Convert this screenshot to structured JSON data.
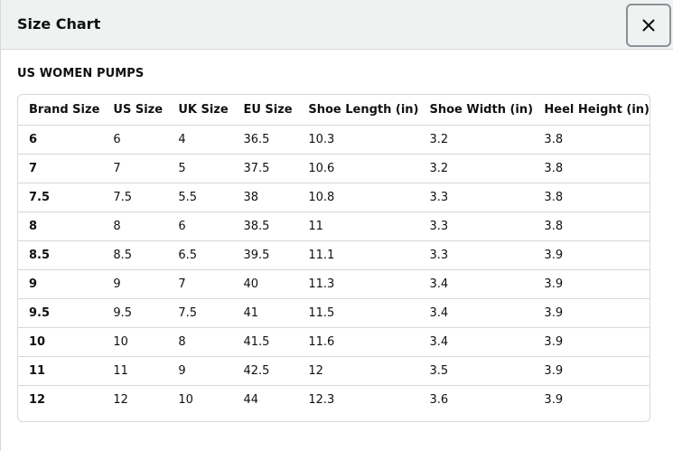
{
  "modal": {
    "title": "Size Chart",
    "close_icon": "close-icon"
  },
  "section_title": "US WOMEN PUMPS",
  "table": {
    "headers": [
      "Brand Size",
      "US Size",
      "UK Size",
      "EU Size",
      "Shoe Length (in)",
      "Shoe Width (in)",
      "Heel Height (in)"
    ],
    "rows": [
      [
        "6",
        "6",
        "4",
        "36.5",
        "10.3",
        "3.2",
        "3.8"
      ],
      [
        "7",
        "7",
        "5",
        "37.5",
        "10.6",
        "3.2",
        "3.8"
      ],
      [
        "7.5",
        "7.5",
        "5.5",
        "38",
        "10.8",
        "3.3",
        "3.8"
      ],
      [
        "8",
        "8",
        "6",
        "38.5",
        "11",
        "3.3",
        "3.8"
      ],
      [
        "8.5",
        "8.5",
        "6.5",
        "39.5",
        "11.1",
        "3.3",
        "3.9"
      ],
      [
        "9",
        "9",
        "7",
        "40",
        "11.3",
        "3.4",
        "3.9"
      ],
      [
        "9.5",
        "9.5",
        "7.5",
        "41",
        "11.5",
        "3.4",
        "3.9"
      ],
      [
        "10",
        "10",
        "8",
        "41.5",
        "11.6",
        "3.4",
        "3.9"
      ],
      [
        "11",
        "11",
        "9",
        "42.5",
        "12",
        "3.5",
        "3.9"
      ],
      [
        "12",
        "12",
        "10",
        "44",
        "12.3",
        "3.6",
        "3.9"
      ]
    ]
  }
}
